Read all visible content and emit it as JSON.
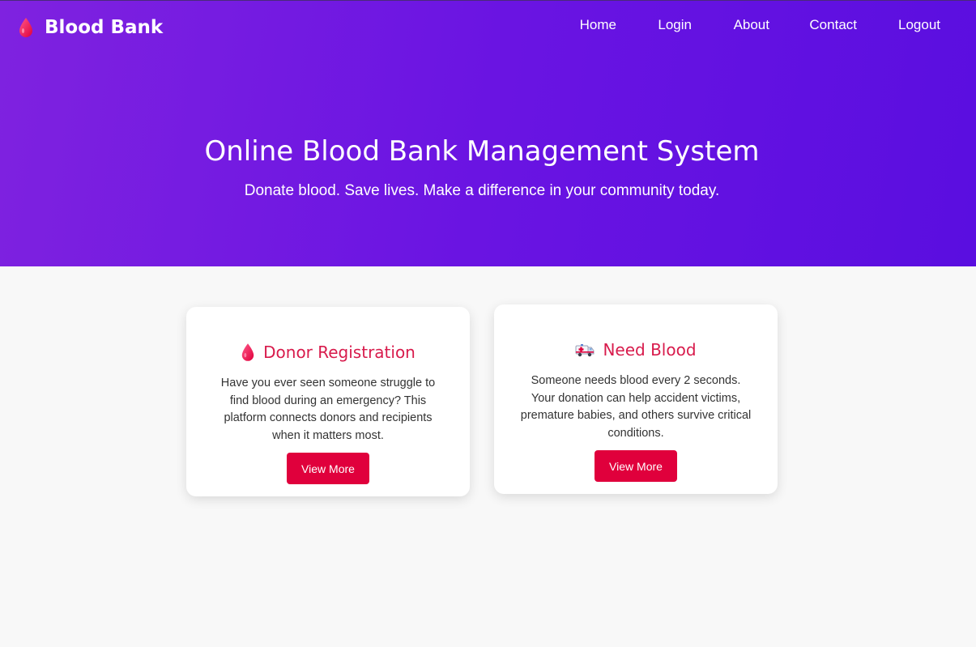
{
  "header": {
    "brand": "Blood Bank",
    "brand_icon": "blood-drop-icon",
    "nav": [
      "Home",
      "Login",
      "About",
      "Contact",
      "Logout"
    ]
  },
  "hero": {
    "title": "Online Blood Bank Management System",
    "subtitle": "Donate blood. Save lives. Make a difference in your community today."
  },
  "cards": [
    {
      "icon": "blood-drop-icon",
      "title": "Donor Registration",
      "text": "Have you ever seen someone struggle to find blood during an emergency? This platform connects donors and recipients when it matters most.",
      "button": "View More"
    },
    {
      "icon": "ambulance-icon",
      "title": "Need Blood",
      "text": "Someone needs blood every 2 seconds. Your donation can help accident victims, premature babies, and others survive critical conditions.",
      "button": "View More"
    }
  ],
  "colors": {
    "hero_start": "#7f22e0",
    "hero_end": "#5a0ee0",
    "accent": "#e0003c",
    "card_title": "#d81b4c",
    "background": "#f8f8f8"
  }
}
